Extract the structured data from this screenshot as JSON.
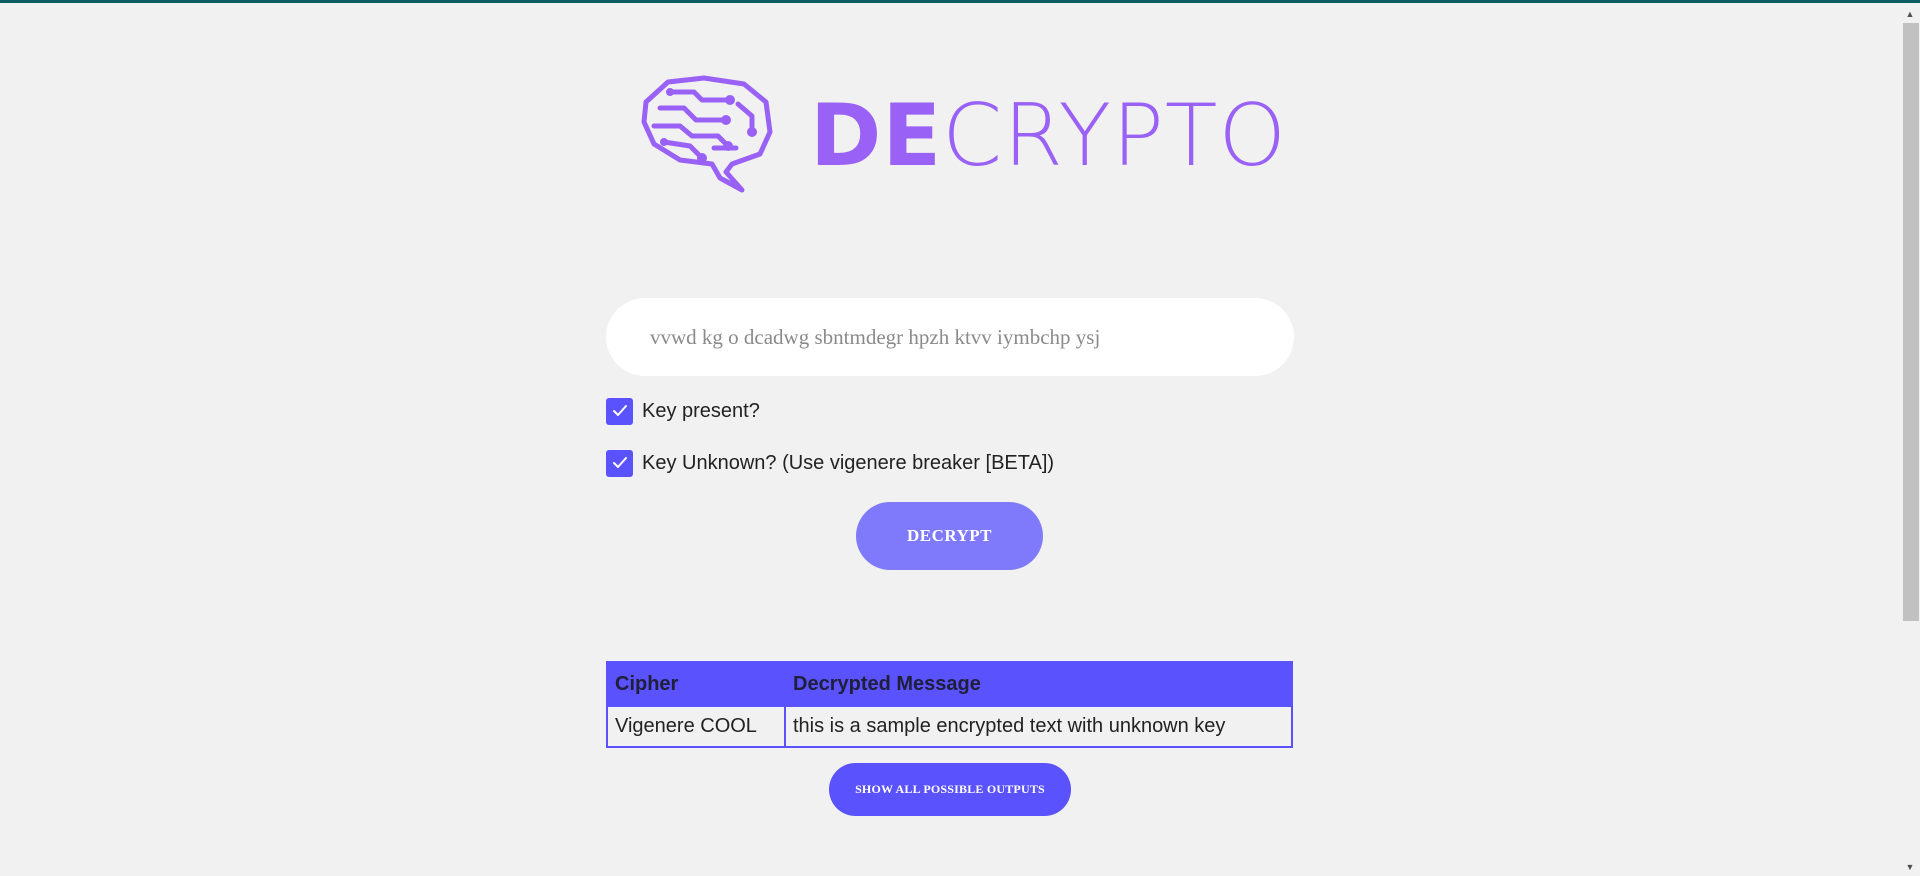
{
  "app": {
    "logo_icon": "brain-circuit-icon",
    "wordmark_bold": "DE",
    "wordmark_light": "CRYPTO",
    "brand_color": "#9961f5",
    "accent_color": "#5952fd"
  },
  "form": {
    "cipher_placeholder": "vvwd kg o dcadwg sbntmdegr hpzh ktvv iymbchp ysj",
    "key_present": {
      "label": "Key present?",
      "checked": true
    },
    "key_unknown": {
      "label": "Key Unknown? (Use vigenere breaker [BETA])",
      "checked": true
    },
    "decrypt_label": "DECRYPT"
  },
  "results": {
    "headers": [
      "Cipher",
      "Decrypted Message"
    ],
    "rows": [
      [
        "Vigenere COOL",
        "this is a sample encrypted text with unknown key"
      ]
    ],
    "show_all_label": "SHOW ALL POSSIBLE OUTPUTS"
  }
}
